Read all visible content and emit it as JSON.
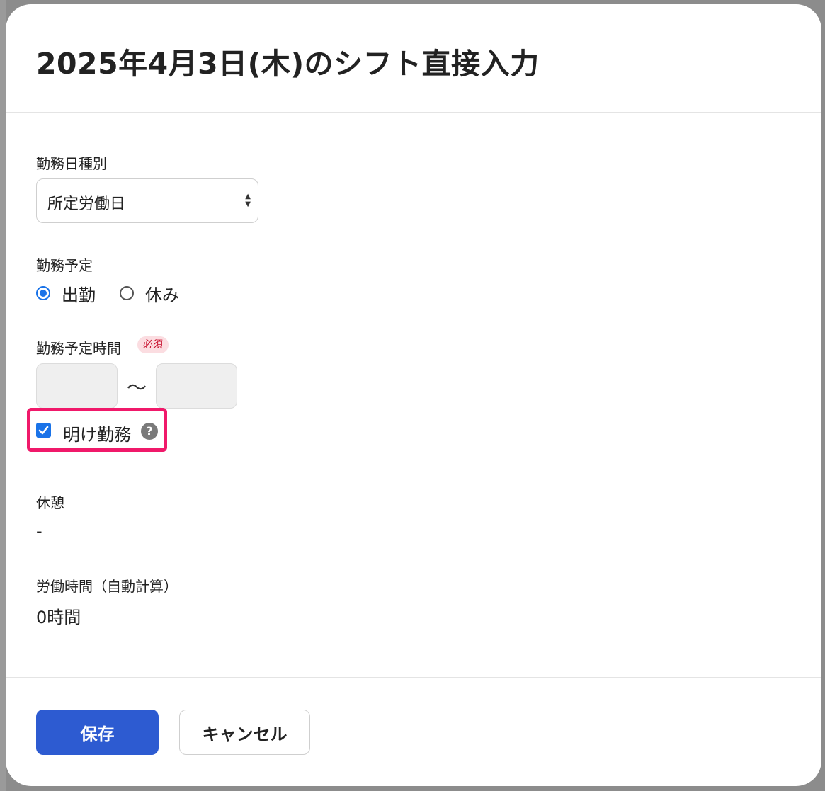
{
  "modal": {
    "title": "2025年4月3日(木)のシフト直接入力"
  },
  "work_day_type": {
    "label": "勤務日種別",
    "selected": "所定労働日"
  },
  "work_schedule": {
    "label": "勤務予定",
    "options": [
      {
        "label": "出勤",
        "checked": true
      },
      {
        "label": "休み",
        "checked": false
      }
    ]
  },
  "work_time": {
    "label": "勤務予定時間",
    "required_badge": "必須",
    "start_value": "",
    "end_value": "",
    "separator": "〜"
  },
  "night_shift": {
    "label": "明け勤務",
    "checked": true,
    "help_glyph": "?"
  },
  "break": {
    "label": "休憩",
    "value": "-"
  },
  "working_hours": {
    "label": "労働時間（自動計算）",
    "value": "0時間"
  },
  "footer": {
    "save_label": "保存",
    "cancel_label": "キャンセル"
  },
  "colors": {
    "accent": "#1a73e8",
    "primary_button": "#2d5bd1",
    "highlight": "#f0196a",
    "required_bg": "#fbdde1",
    "required_text": "#c8102e"
  }
}
